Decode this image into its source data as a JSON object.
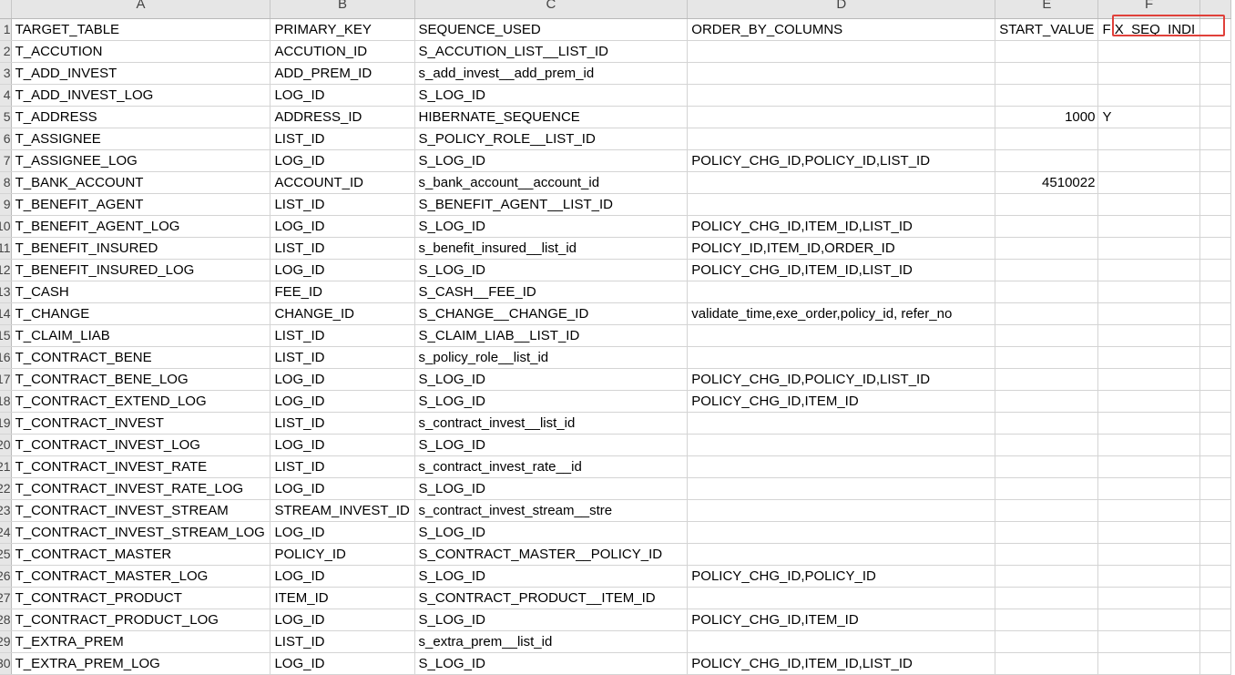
{
  "columns": [
    "A",
    "B",
    "C",
    "D",
    "E",
    "F"
  ],
  "row_numbers": [
    "1",
    "2",
    "3",
    "4",
    "5",
    "6",
    "7",
    "8",
    "9",
    "10",
    "11",
    "12",
    "13",
    "14",
    "15",
    "16",
    "17",
    "18",
    "19",
    "20",
    "21",
    "22",
    "23",
    "24",
    "25",
    "26",
    "27",
    "28",
    "29",
    "30"
  ],
  "rows": [
    [
      "TARGET_TABLE",
      "PRIMARY_KEY",
      "SEQUENCE_USED",
      "ORDER_BY_COLUMNS",
      "START_VALUE",
      "FIX_SEQ_INDI"
    ],
    [
      "T_ACCUTION",
      "ACCUTION_ID",
      "S_ACCUTION_LIST__LIST_ID",
      "",
      "",
      ""
    ],
    [
      "T_ADD_INVEST",
      "ADD_PREM_ID",
      "s_add_invest__add_prem_id",
      "",
      "",
      ""
    ],
    [
      "T_ADD_INVEST_LOG",
      "LOG_ID",
      "S_LOG_ID",
      "",
      "",
      ""
    ],
    [
      "T_ADDRESS",
      "ADDRESS_ID",
      "HIBERNATE_SEQUENCE",
      "",
      "1000",
      "Y"
    ],
    [
      "T_ASSIGNEE",
      "LIST_ID",
      "S_POLICY_ROLE__LIST_ID",
      "",
      "",
      ""
    ],
    [
      "T_ASSIGNEE_LOG",
      "LOG_ID",
      "S_LOG_ID",
      "POLICY_CHG_ID,POLICY_ID,LIST_ID",
      "",
      ""
    ],
    [
      "T_BANK_ACCOUNT",
      "ACCOUNT_ID",
      "s_bank_account__account_id",
      "",
      "4510022",
      ""
    ],
    [
      "T_BENEFIT_AGENT",
      "LIST_ID",
      "S_BENEFIT_AGENT__LIST_ID",
      "",
      "",
      ""
    ],
    [
      "T_BENEFIT_AGENT_LOG",
      "LOG_ID",
      "S_LOG_ID",
      "POLICY_CHG_ID,ITEM_ID,LIST_ID",
      "",
      ""
    ],
    [
      "T_BENEFIT_INSURED",
      "LIST_ID",
      "s_benefit_insured__list_id",
      "POLICY_ID,ITEM_ID,ORDER_ID",
      "",
      ""
    ],
    [
      "T_BENEFIT_INSURED_LOG",
      "LOG_ID",
      "S_LOG_ID",
      "POLICY_CHG_ID,ITEM_ID,LIST_ID",
      "",
      ""
    ],
    [
      "T_CASH",
      "FEE_ID",
      "S_CASH__FEE_ID",
      "",
      "",
      ""
    ],
    [
      "T_CHANGE",
      "CHANGE_ID",
      "S_CHANGE__CHANGE_ID",
      "validate_time,exe_order,policy_id, refer_no",
      "",
      ""
    ],
    [
      "T_CLAIM_LIAB",
      "LIST_ID",
      "S_CLAIM_LIAB__LIST_ID",
      "",
      "",
      ""
    ],
    [
      "T_CONTRACT_BENE",
      "LIST_ID",
      "s_policy_role__list_id",
      "",
      "",
      ""
    ],
    [
      "T_CONTRACT_BENE_LOG",
      "LOG_ID",
      "S_LOG_ID",
      "POLICY_CHG_ID,POLICY_ID,LIST_ID",
      "",
      ""
    ],
    [
      "T_CONTRACT_EXTEND_LOG",
      "LOG_ID",
      "S_LOG_ID",
      "POLICY_CHG_ID,ITEM_ID",
      "",
      ""
    ],
    [
      "T_CONTRACT_INVEST",
      "LIST_ID",
      "s_contract_invest__list_id",
      "",
      "",
      ""
    ],
    [
      "T_CONTRACT_INVEST_LOG",
      "LOG_ID",
      "S_LOG_ID",
      "",
      "",
      ""
    ],
    [
      "T_CONTRACT_INVEST_RATE",
      "LIST_ID",
      "s_contract_invest_rate__id",
      "",
      "",
      ""
    ],
    [
      "T_CONTRACT_INVEST_RATE_LOG",
      "LOG_ID",
      "S_LOG_ID",
      "",
      "",
      ""
    ],
    [
      "T_CONTRACT_INVEST_STREAM",
      "STREAM_INVEST_ID",
      "s_contract_invest_stream__stre",
      "",
      "",
      ""
    ],
    [
      "T_CONTRACT_INVEST_STREAM_LOG",
      "LOG_ID",
      "S_LOG_ID",
      "",
      "",
      ""
    ],
    [
      "T_CONTRACT_MASTER",
      "POLICY_ID",
      "S_CONTRACT_MASTER__POLICY_ID",
      "",
      "",
      ""
    ],
    [
      "T_CONTRACT_MASTER_LOG",
      "LOG_ID",
      "S_LOG_ID",
      "POLICY_CHG_ID,POLICY_ID",
      "",
      ""
    ],
    [
      "T_CONTRACT_PRODUCT",
      "ITEM_ID",
      "S_CONTRACT_PRODUCT__ITEM_ID",
      "",
      "",
      ""
    ],
    [
      "T_CONTRACT_PRODUCT_LOG",
      "LOG_ID",
      "S_LOG_ID",
      "POLICY_CHG_ID,ITEM_ID",
      "",
      ""
    ],
    [
      "T_EXTRA_PREM",
      "LIST_ID",
      "s_extra_prem__list_id",
      "",
      "",
      ""
    ],
    [
      "T_EXTRA_PREM_LOG",
      "LOG_ID",
      "S_LOG_ID",
      "POLICY_CHG_ID,ITEM_ID,LIST_ID",
      "",
      ""
    ]
  ],
  "highlight_color": "#e0403a"
}
